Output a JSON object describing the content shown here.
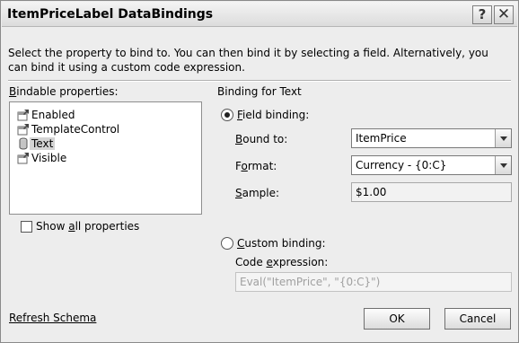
{
  "window": {
    "title": "ItemPriceLabel DataBindings",
    "help_glyph": "?",
    "close_glyph": "✕"
  },
  "description": "Select the property to bind to. You can then bind it by selecting a field. Alternatively, you can bind it using a custom code expression.",
  "bindable": {
    "label_pre": "",
    "label_u": "B",
    "label_post": "indable properties:",
    "items": [
      {
        "label": "Enabled",
        "icon": "property-icon",
        "selected": false
      },
      {
        "label": "TemplateControl",
        "icon": "property-icon",
        "selected": false
      },
      {
        "label": "Text",
        "icon": "cylinder-icon",
        "selected": true
      },
      {
        "label": "Visible",
        "icon": "property-icon",
        "selected": false
      }
    ],
    "show_all_pre": "Show ",
    "show_all_u": "a",
    "show_all_post": "ll properties",
    "show_all_checked": false
  },
  "binding": {
    "header": "Binding for Text",
    "field_binding_u": "F",
    "field_binding_post": "ield binding:",
    "field_binding_selected": true,
    "bound_to_u": "B",
    "bound_to_post": "ound to:",
    "bound_to_value": "ItemPrice",
    "format_pre": "F",
    "format_u": "o",
    "format_post": "rmat:",
    "format_value": "Currency - {0:C}",
    "sample_u": "S",
    "sample_post": "ample:",
    "sample_value": "$1.00",
    "custom_u": "C",
    "custom_post": "ustom binding:",
    "custom_selected": false,
    "code_pre": "Code ",
    "code_u": "e",
    "code_post": "xpression:",
    "code_value": "Eval(\"ItemPrice\", \"{0:C}\")"
  },
  "footer": {
    "refresh": "Refresh Schema",
    "ok": "OK",
    "cancel": "Cancel"
  }
}
